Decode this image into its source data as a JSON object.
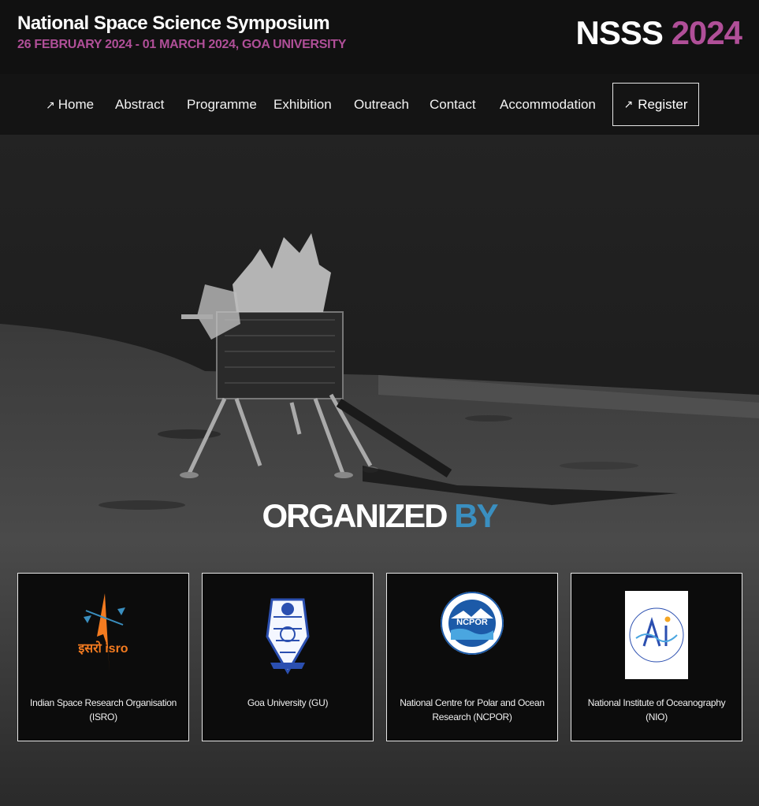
{
  "header": {
    "title": "National Space Science Symposium",
    "subtitle": "26 FEBRUARY 2024 - 01 MARCH 2024, GOA UNIVERSITY",
    "brand_primary": "NSSS",
    "brand_year": "2024"
  },
  "nav": {
    "items": [
      {
        "label": "Home",
        "icon": "arrow-up-right-icon"
      },
      {
        "label": "Abstract"
      },
      {
        "label": "Programme"
      },
      {
        "label": "Exhibition"
      },
      {
        "label": "Outreach"
      },
      {
        "label": "Contact"
      },
      {
        "label": "Accommodation"
      }
    ],
    "register": {
      "label": "Register",
      "icon": "arrow-up-right-icon"
    }
  },
  "organized": {
    "title_main": "ORGANIZED",
    "title_accent": "BY",
    "cards": [
      {
        "caption": "Indian Space Research Organisation (ISRO)",
        "logo": "isro-logo",
        "logo_text": "इसरो isro"
      },
      {
        "caption": "Goa University (GU)",
        "logo": "goa-university-logo"
      },
      {
        "caption": "National Centre for Polar and Ocean Research (NCPOR)",
        "logo": "ncpor-logo",
        "logo_text": "NCPOR"
      },
      {
        "caption": "National Institute of Oceanography (NIO)",
        "logo": "nio-logo"
      }
    ]
  },
  "colors": {
    "accent_purple": "#b04f98",
    "accent_blue": "#3a8fc0",
    "isro_orange": "#f47b20",
    "background": "#111111"
  }
}
